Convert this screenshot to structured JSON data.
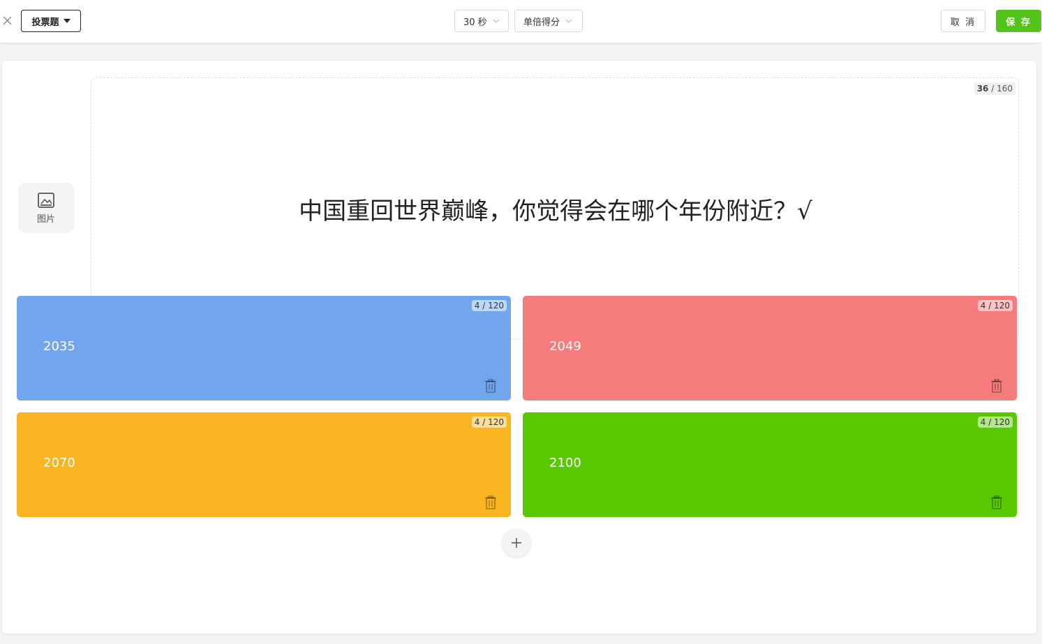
{
  "toolbar": {
    "question_type": "投票题",
    "time_limit": "30 秒",
    "score_mode": "单倍得分",
    "cancel_label": "取 消",
    "save_label": "保 存"
  },
  "question": {
    "image_button_label": "图片",
    "text": "中国重回世界巅峰，你觉得会在哪个年份附近？√",
    "char_count": "36",
    "char_limit": "/ 160"
  },
  "answers": [
    {
      "text": "2035",
      "counter": "4 / 120",
      "color": "#71a6ee"
    },
    {
      "text": "2049",
      "counter": "4 / 120",
      "color": "#f67b7c"
    },
    {
      "text": "2070",
      "counter": "4 / 120",
      "color": "#f9b522"
    },
    {
      "text": "2100",
      "counter": "4 / 120",
      "color": "#5ac800"
    }
  ],
  "colors": {
    "save_button": "#52c41a"
  },
  "icons": {
    "close": "close-icon",
    "caret": "caret-down-icon",
    "chevron": "chevron-down-icon",
    "image": "image-icon",
    "trash": "trash-icon",
    "add": "plus-icon"
  }
}
